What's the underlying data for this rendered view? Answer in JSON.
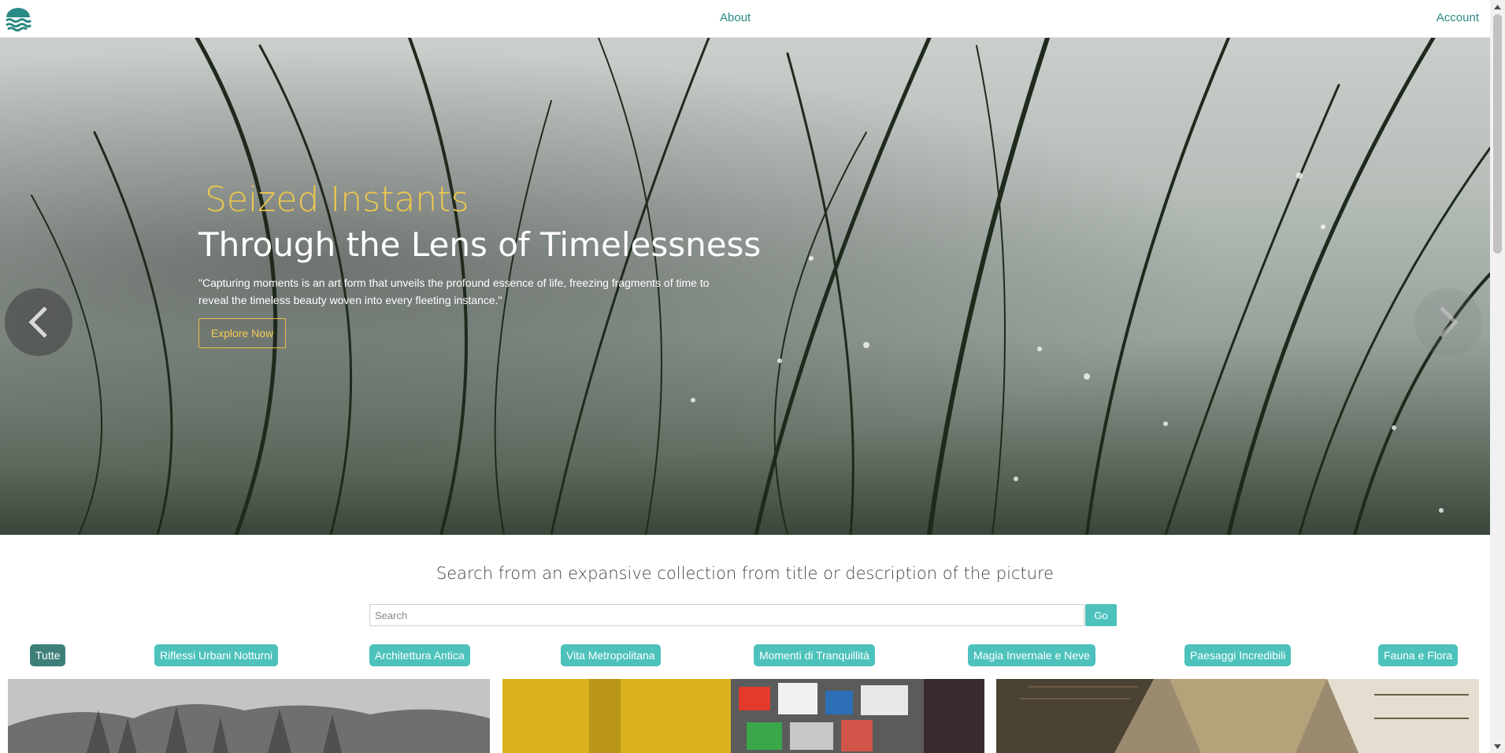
{
  "colors": {
    "accent": "#4dc2bc",
    "accent_active": "#3f7f7a",
    "nav_link": "#2a8a86",
    "hero_highlight": "#f0c94a"
  },
  "navbar": {
    "logo_icon": "waves-logo-icon",
    "about_label": "About",
    "account_label": "Account"
  },
  "hero": {
    "subtitle": "Seized Instants",
    "title": "Through the Lens of Timelessness",
    "quote": "\"Capturing moments is an art form that unveils the profound essence of life, freezing fragments of time to reveal the timeless beauty woven into every fleeting instance.\"",
    "cta_label": "Explore Now",
    "prev_icon": "chevron-left-icon",
    "next_icon": "chevron-right-icon"
  },
  "search": {
    "heading": "Search from an expansive collection from title or description of the picture",
    "placeholder": "Search",
    "value": "",
    "go_label": "Go"
  },
  "categories": [
    {
      "label": "Tutte",
      "active": true
    },
    {
      "label": "Riflessi Urbani Notturni",
      "active": false
    },
    {
      "label": "Architettura Antica",
      "active": false
    },
    {
      "label": "Vita Metropolitana",
      "active": false
    },
    {
      "label": "Momenti di Tranquillità",
      "active": false
    },
    {
      "label": "Magia Invernale e Neve",
      "active": false
    },
    {
      "label": "Paesaggi Incredibili",
      "active": false
    },
    {
      "label": "Fauna e Flora",
      "active": false
    }
  ]
}
